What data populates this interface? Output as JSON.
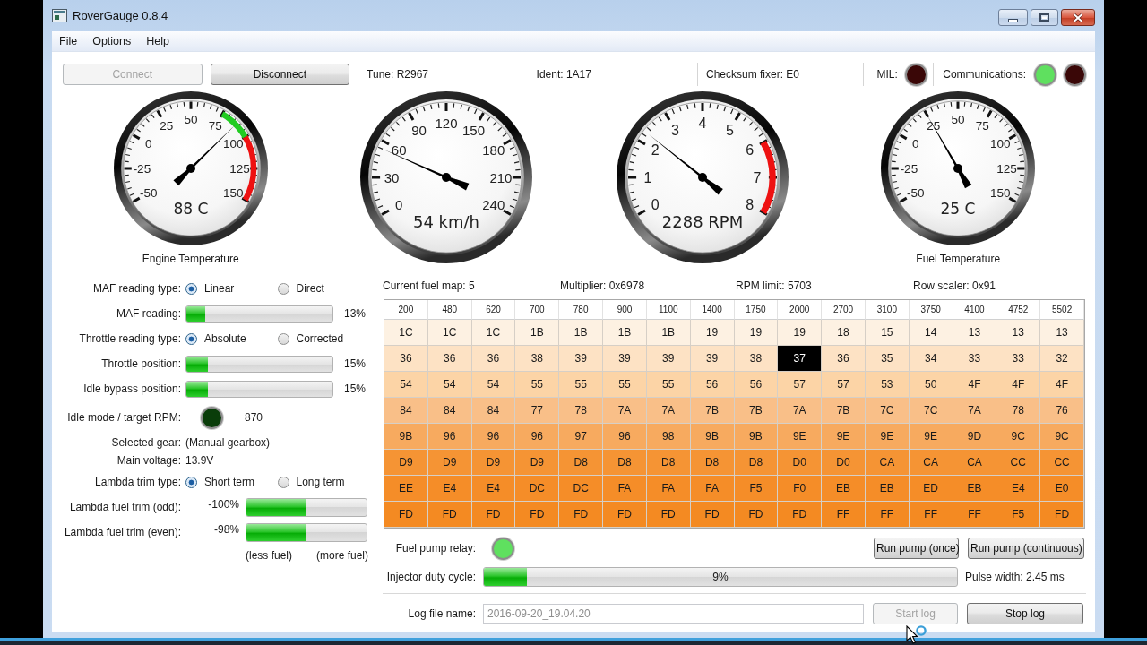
{
  "window": {
    "title": "RoverGauge 0.8.4"
  },
  "menu": [
    "File",
    "Options",
    "Help"
  ],
  "toolbar": {
    "buttons": [
      {
        "label": "Connect",
        "disabled": true
      },
      {
        "label": "Disconnect",
        "disabled": false
      }
    ],
    "fields": [
      "Tune: R2967",
      "Ident: 1A17",
      "Checksum fixer: E0"
    ],
    "mil": {
      "label": "MIL:",
      "color": "#3a0707"
    },
    "communications": {
      "label": "Communications:",
      "lights": [
        {
          "color": "#5fe05f"
        },
        {
          "color": "#3a0707"
        }
      ]
    }
  },
  "gauges": [
    {
      "kind": "thermometer",
      "ticks": [
        {
          "label": "-50"
        },
        {
          "label": "-25"
        },
        {
          "label": "0"
        },
        {
          "label": "25"
        },
        {
          "label": "50"
        },
        {
          "label": "75",
          "color": "#22cc22"
        },
        {
          "label": "100",
          "color": "#ee1111"
        },
        {
          "label": "125",
          "color": "#ee1111"
        },
        {
          "label": "150"
        }
      ],
      "level": 0.69,
      "reading": "88 C",
      "caption": "Engine Temperature"
    },
    {
      "kind": "speedometer",
      "ticks": [
        {
          "label": "0"
        },
        {
          "label": "30"
        },
        {
          "label": "60"
        },
        {
          "label": "90"
        },
        {
          "label": "120"
        },
        {
          "label": "150"
        },
        {
          "label": "180"
        },
        {
          "label": "210"
        },
        {
          "label": "240"
        }
      ],
      "level": 0.225,
      "reading": "54 km/h"
    },
    {
      "kind": "tachometer",
      "ticks": [
        {
          "label": "0"
        },
        {
          "label": "1"
        },
        {
          "label": "2"
        },
        {
          "label": "3"
        },
        {
          "label": "4"
        },
        {
          "label": "5"
        },
        {
          "label": "6",
          "color": "#ee1111"
        },
        {
          "label": "7",
          "color": "#ee1111"
        },
        {
          "label": "8"
        }
      ],
      "level": 0.286,
      "reading": "2288 RPM"
    },
    {
      "kind": "thermometer",
      "ticks": [
        {
          "label": "-50"
        },
        {
          "label": "-25"
        },
        {
          "label": "0"
        },
        {
          "label": "25"
        },
        {
          "label": "50"
        },
        {
          "label": "75"
        },
        {
          "label": "100"
        },
        {
          "label": "125"
        },
        {
          "label": "150"
        }
      ],
      "level": 0.375,
      "reading": "25 C",
      "caption": "Fuel Temperature"
    }
  ],
  "readings": [
    {
      "kind": "radio",
      "label": "MAF reading type:",
      "options": [
        {
          "label": "Linear",
          "selected": true
        },
        {
          "label": "Direct",
          "selected": false
        }
      ]
    },
    {
      "kind": "bar",
      "label": "MAF reading:",
      "level": 0.13,
      "reading": "13%"
    },
    {
      "kind": "radio",
      "label": "Throttle reading type:",
      "options": [
        {
          "label": "Absolute",
          "selected": true
        },
        {
          "label": "Corrected",
          "selected": false
        }
      ]
    },
    {
      "kind": "bar",
      "label": "Throttle position:",
      "level": 0.15,
      "reading": "15%"
    },
    {
      "kind": "bar",
      "label": "Idle bypass position:",
      "level": 0.15,
      "reading": "15%"
    },
    {
      "kind": "light",
      "label": "Idle mode / target RPM:",
      "color": "#0a3d0a",
      "value": "870"
    },
    {
      "kind": "text",
      "label": "Selected gear:",
      "value": "(Manual gearbox)"
    },
    {
      "kind": "text",
      "label": "Main voltage:",
      "value": "13.9V"
    },
    {
      "kind": "radio",
      "label": "Lambda trim type:",
      "options": [
        {
          "label": "Short term",
          "selected": true
        },
        {
          "label": "Long term",
          "selected": false
        }
      ]
    },
    {
      "kind": "trim",
      "label": "Lambda fuel trim (odd):",
      "reading": "-100%",
      "level": 0.5
    },
    {
      "kind": "trim",
      "label": "Lambda fuel trim (even):",
      "reading": "-98%",
      "level": 0.5
    },
    {
      "kind": "legend",
      "labels": [
        "(less fuel)",
        "(more fuel)"
      ]
    }
  ],
  "fuel_map": {
    "info": [
      "Current fuel map: 5",
      "Multiplier: 0x6978",
      "RPM limit: 5703",
      "Row scaler: 0x91"
    ],
    "columns": [
      "200",
      "480",
      "620",
      "700",
      "780",
      "900",
      "1100",
      "1400",
      "1750",
      "2000",
      "2700",
      "3100",
      "3750",
      "4100",
      "4752",
      "5502"
    ],
    "rows": [
      {
        "cells": [
          {
            "value": "1C",
            "selected": false
          },
          {
            "value": "1C",
            "selected": false
          },
          {
            "value": "1C",
            "selected": false
          },
          {
            "value": "1B",
            "selected": false
          },
          {
            "value": "1B",
            "selected": false
          },
          {
            "value": "1B",
            "selected": false
          },
          {
            "value": "1B",
            "selected": false
          },
          {
            "value": "19",
            "selected": false
          },
          {
            "value": "19",
            "selected": false
          },
          {
            "value": "19",
            "selected": false
          },
          {
            "value": "18",
            "selected": false
          },
          {
            "value": "15",
            "selected": false
          },
          {
            "value": "14",
            "selected": false
          },
          {
            "value": "13",
            "selected": false
          },
          {
            "value": "13",
            "selected": false
          },
          {
            "value": "13",
            "selected": false
          }
        ]
      },
      {
        "cells": [
          {
            "value": "36",
            "selected": false
          },
          {
            "value": "36",
            "selected": false
          },
          {
            "value": "36",
            "selected": false
          },
          {
            "value": "38",
            "selected": false
          },
          {
            "value": "39",
            "selected": false
          },
          {
            "value": "39",
            "selected": false
          },
          {
            "value": "39",
            "selected": false
          },
          {
            "value": "39",
            "selected": false
          },
          {
            "value": "38",
            "selected": false
          },
          {
            "value": "37",
            "selected": true
          },
          {
            "value": "36",
            "selected": false
          },
          {
            "value": "35",
            "selected": false
          },
          {
            "value": "34",
            "selected": false
          },
          {
            "value": "33",
            "selected": false
          },
          {
            "value": "33",
            "selected": false
          },
          {
            "value": "32",
            "selected": false
          }
        ]
      },
      {
        "cells": [
          {
            "value": "54",
            "selected": false
          },
          {
            "value": "54",
            "selected": false
          },
          {
            "value": "54",
            "selected": false
          },
          {
            "value": "55",
            "selected": false
          },
          {
            "value": "55",
            "selected": false
          },
          {
            "value": "55",
            "selected": false
          },
          {
            "value": "55",
            "selected": false
          },
          {
            "value": "56",
            "selected": false
          },
          {
            "value": "56",
            "selected": false
          },
          {
            "value": "57",
            "selected": false
          },
          {
            "value": "57",
            "selected": false
          },
          {
            "value": "53",
            "selected": false
          },
          {
            "value": "50",
            "selected": false
          },
          {
            "value": "4F",
            "selected": false
          },
          {
            "value": "4F",
            "selected": false
          },
          {
            "value": "4F",
            "selected": false
          }
        ]
      },
      {
        "cells": [
          {
            "value": "84",
            "selected": false
          },
          {
            "value": "84",
            "selected": false
          },
          {
            "value": "84",
            "selected": false
          },
          {
            "value": "77",
            "selected": false
          },
          {
            "value": "78",
            "selected": false
          },
          {
            "value": "7A",
            "selected": false
          },
          {
            "value": "7A",
            "selected": false
          },
          {
            "value": "7B",
            "selected": false
          },
          {
            "value": "7B",
            "selected": false
          },
          {
            "value": "7A",
            "selected": false
          },
          {
            "value": "7B",
            "selected": false
          },
          {
            "value": "7C",
            "selected": false
          },
          {
            "value": "7C",
            "selected": false
          },
          {
            "value": "7A",
            "selected": false
          },
          {
            "value": "78",
            "selected": false
          },
          {
            "value": "76",
            "selected": false
          }
        ]
      },
      {
        "cells": [
          {
            "value": "9B",
            "selected": false
          },
          {
            "value": "96",
            "selected": false
          },
          {
            "value": "96",
            "selected": false
          },
          {
            "value": "96",
            "selected": false
          },
          {
            "value": "97",
            "selected": false
          },
          {
            "value": "96",
            "selected": false
          },
          {
            "value": "98",
            "selected": false
          },
          {
            "value": "9B",
            "selected": false
          },
          {
            "value": "9B",
            "selected": false
          },
          {
            "value": "9E",
            "selected": false
          },
          {
            "value": "9E",
            "selected": false
          },
          {
            "value": "9E",
            "selected": false
          },
          {
            "value": "9E",
            "selected": false
          },
          {
            "value": "9D",
            "selected": false
          },
          {
            "value": "9C",
            "selected": false
          },
          {
            "value": "9C",
            "selected": false
          }
        ]
      },
      {
        "cells": [
          {
            "value": "D9",
            "selected": false
          },
          {
            "value": "D9",
            "selected": false
          },
          {
            "value": "D9",
            "selected": false
          },
          {
            "value": "D9",
            "selected": false
          },
          {
            "value": "D8",
            "selected": false
          },
          {
            "value": "D8",
            "selected": false
          },
          {
            "value": "D8",
            "selected": false
          },
          {
            "value": "D8",
            "selected": false
          },
          {
            "value": "D8",
            "selected": false
          },
          {
            "value": "D0",
            "selected": false
          },
          {
            "value": "D0",
            "selected": false
          },
          {
            "value": "CA",
            "selected": false
          },
          {
            "value": "CA",
            "selected": false
          },
          {
            "value": "CA",
            "selected": false
          },
          {
            "value": "CC",
            "selected": false
          },
          {
            "value": "CC",
            "selected": false
          }
        ]
      },
      {
        "cells": [
          {
            "value": "EE",
            "selected": false
          },
          {
            "value": "E4",
            "selected": false
          },
          {
            "value": "E4",
            "selected": false
          },
          {
            "value": "DC",
            "selected": false
          },
          {
            "value": "DC",
            "selected": false
          },
          {
            "value": "FA",
            "selected": false
          },
          {
            "value": "FA",
            "selected": false
          },
          {
            "value": "FA",
            "selected": false
          },
          {
            "value": "F5",
            "selected": false
          },
          {
            "value": "F0",
            "selected": false
          },
          {
            "value": "EB",
            "selected": false
          },
          {
            "value": "EB",
            "selected": false
          },
          {
            "value": "ED",
            "selected": false
          },
          {
            "value": "EB",
            "selected": false
          },
          {
            "value": "E4",
            "selected": false
          },
          {
            "value": "E0",
            "selected": false
          }
        ]
      },
      {
        "cells": [
          {
            "value": "FD",
            "selected": false
          },
          {
            "value": "FD",
            "selected": false
          },
          {
            "value": "FD",
            "selected": false
          },
          {
            "value": "FD",
            "selected": false
          },
          {
            "value": "FD",
            "selected": false
          },
          {
            "value": "FD",
            "selected": false
          },
          {
            "value": "FD",
            "selected": false
          },
          {
            "value": "FD",
            "selected": false
          },
          {
            "value": "FD",
            "selected": false
          },
          {
            "value": "FD",
            "selected": false
          },
          {
            "value": "FF",
            "selected": false
          },
          {
            "value": "FF",
            "selected": false
          },
          {
            "value": "FF",
            "selected": false
          },
          {
            "value": "FF",
            "selected": false
          },
          {
            "value": "F5",
            "selected": false
          },
          {
            "value": "FD",
            "selected": false
          }
        ]
      }
    ]
  },
  "fuel_pump": {
    "label": "Fuel pump relay:",
    "color": "#5fe05f",
    "buttons": [
      {
        "label": "Run pump (once)",
        "disabled": false
      },
      {
        "label": "Run pump (continuous)",
        "disabled": false
      }
    ]
  },
  "injector": {
    "label": "Injector duty cycle:",
    "level": 0.09,
    "reading": "9%",
    "pulse_width": "Pulse width: 2.45 ms"
  },
  "log": {
    "label": "Log file name:",
    "value": "2016-09-20_19.04.20",
    "disabled": true,
    "buttons": [
      {
        "label": "Start log",
        "disabled": true
      },
      {
        "label": "Stop log",
        "disabled": false
      }
    ]
  }
}
